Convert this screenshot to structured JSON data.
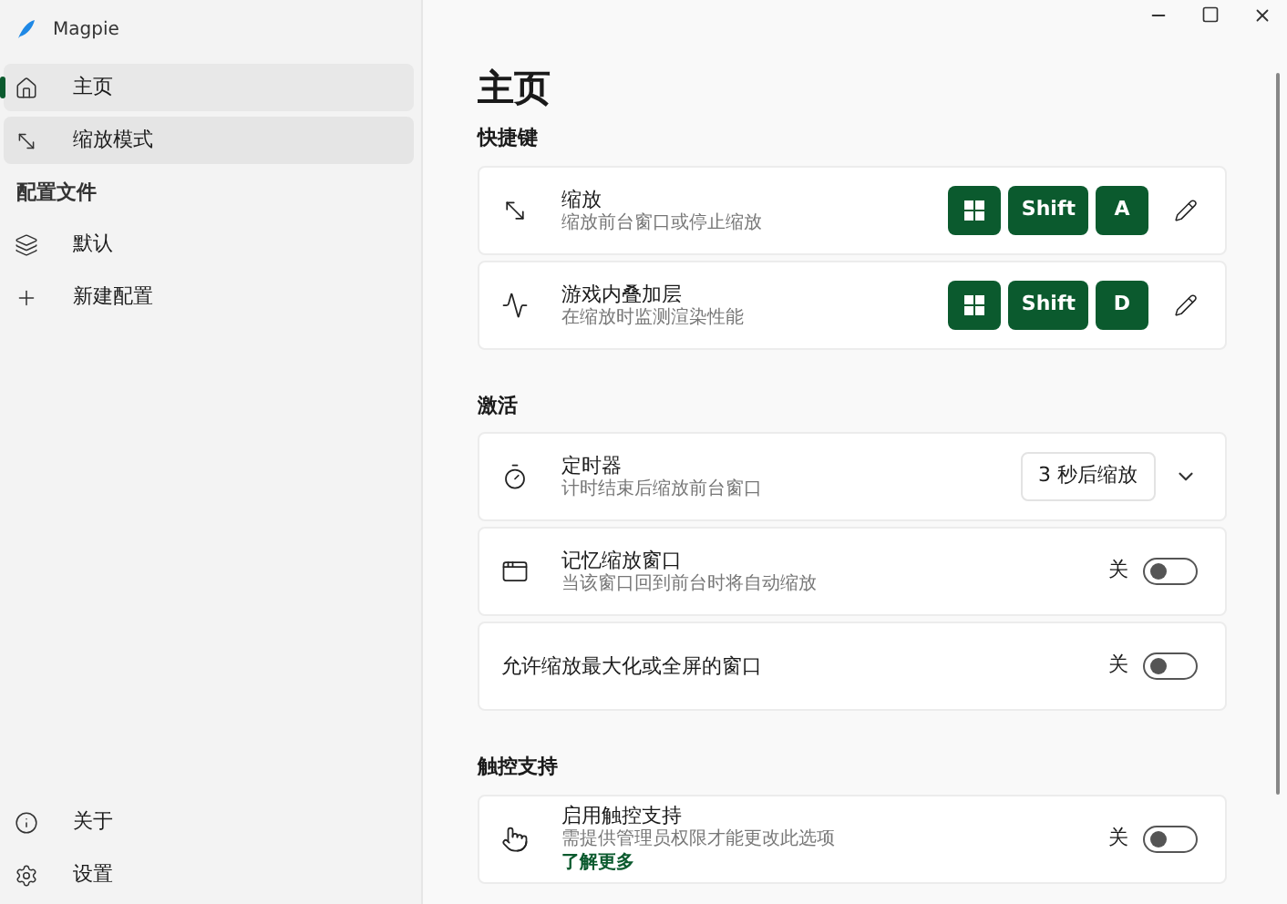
{
  "app": {
    "title": "Magpie"
  },
  "nav": [
    {
      "label": "主页",
      "selected": true,
      "hovered": false
    },
    {
      "label": "缩放模式",
      "selected": false,
      "hovered": true
    }
  ],
  "profiles_header": "配置文件",
  "profiles": [
    {
      "kind": "profile",
      "label": "默认"
    },
    {
      "kind": "add",
      "label": "新建配置"
    }
  ],
  "footer_nav": [
    {
      "label": "关于"
    },
    {
      "label": "设置"
    }
  ],
  "page_title": "主页",
  "sections": [
    {
      "title": "快捷键",
      "rows": [
        {
          "kind": "shortcut",
          "title": "缩放",
          "description": "缩放前台窗口或停止缩放",
          "keys": [
            {
              "kind": "win"
            },
            {
              "kind": "text",
              "label": "Shift"
            },
            {
              "kind": "text",
              "label": "A"
            }
          ]
        },
        {
          "kind": "shortcut",
          "title": "游戏内叠加层",
          "description": "在缩放时监测渲染性能",
          "keys": [
            {
              "kind": "win"
            },
            {
              "kind": "text",
              "label": "Shift"
            },
            {
              "kind": "text",
              "label": "D"
            }
          ]
        }
      ]
    },
    {
      "title": "激活",
      "rows": [
        {
          "kind": "dropdown",
          "title": "定时器",
          "description": "计时结束后缩放前台窗口",
          "value": "3 秒后缩放"
        },
        {
          "kind": "toggle",
          "title": "记忆缩放窗口",
          "description": "当该窗口回到前台时将自动缩放",
          "state_label": "关",
          "on": false
        },
        {
          "kind": "toggle",
          "title": "允许缩放最大化或全屏的窗口",
          "state_label": "关",
          "on": false
        }
      ]
    },
    {
      "title": "触控支持",
      "rows": [
        {
          "kind": "toggle",
          "title": "启用触控支持",
          "description": "需提供管理员权限才能更改此选项",
          "link": "了解更多",
          "state_label": "关",
          "on": false
        }
      ]
    }
  ]
}
